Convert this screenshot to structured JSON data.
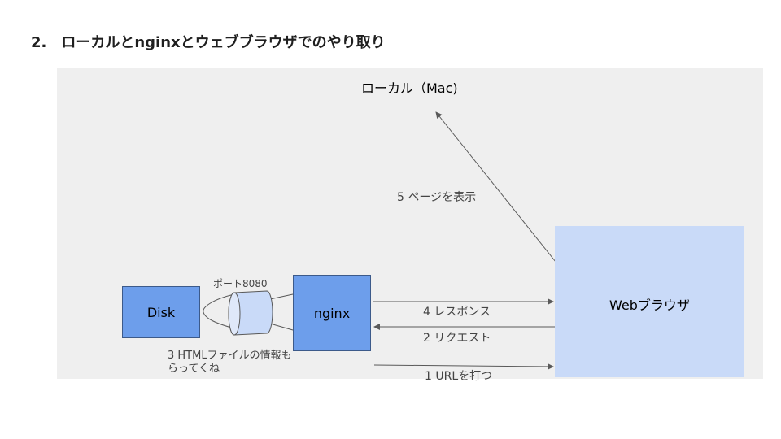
{
  "slide": {
    "title": "2.　ローカルとnginxとウェブブラウザでのやり取り"
  },
  "nodes": {
    "local": "ローカル（Mac)",
    "disk": "Disk",
    "nginx": "nginx",
    "browser": "Webブラウザ"
  },
  "edges": {
    "port": "ポート8080",
    "step1": "1 URLを打つ",
    "step2": "2 リクエスト",
    "step3_line1": "3 HTMLファイルの情報も",
    "step3_line2": "らってくね",
    "step4": "4 レスポンス",
    "step5": "5 ページを表示"
  },
  "colors": {
    "node_fill": "#6d9eeb",
    "browser_fill": "#c9daf8",
    "panel_fill": "#efefef",
    "line": "#595959",
    "cylinder_fill": "#c9daf8"
  }
}
